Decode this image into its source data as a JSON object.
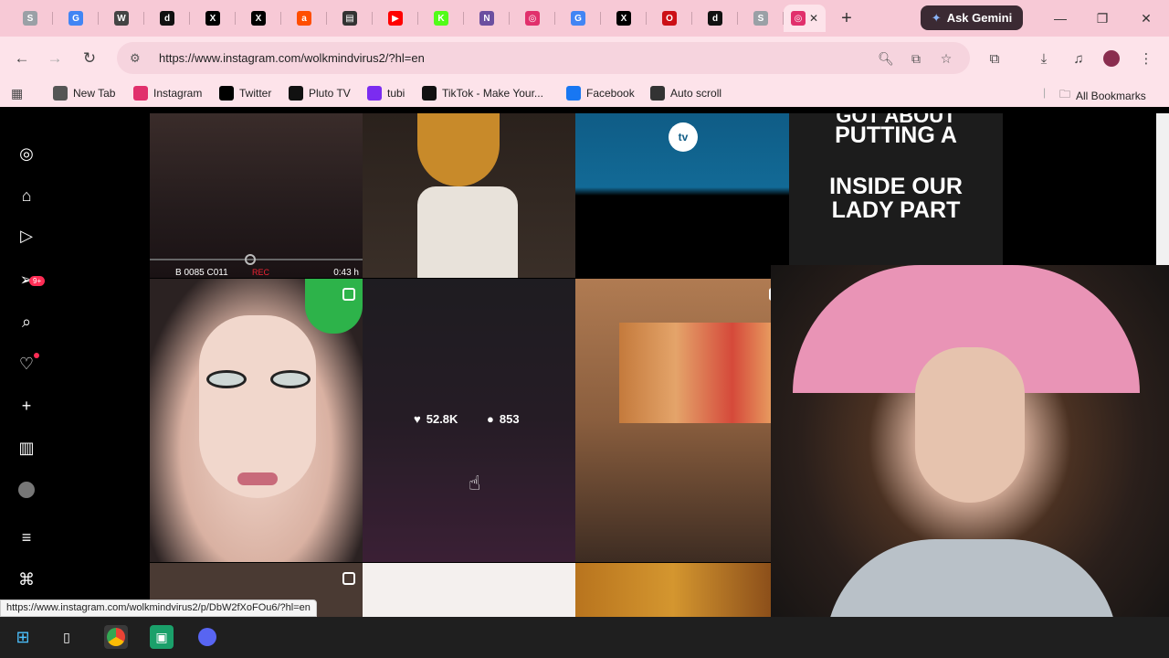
{
  "browser": {
    "tabs": [
      {
        "icon": "chrome-icon",
        "color": "#9aa0a6",
        "label": "S"
      },
      {
        "icon": "google-icon",
        "color": "#4285f4",
        "label": "G"
      },
      {
        "icon": "app-icon",
        "color": "#444444",
        "label": "W"
      },
      {
        "icon": "tiktok-icon",
        "color": "#111111",
        "label": "d"
      },
      {
        "icon": "x-icon",
        "color": "#000000",
        "label": "X"
      },
      {
        "icon": "x-icon",
        "color": "#000000",
        "label": "X"
      },
      {
        "icon": "ars-icon",
        "color": "#ff4e00",
        "label": "a"
      },
      {
        "icon": "news-icon",
        "color": "#333333",
        "label": "▤"
      },
      {
        "icon": "youtube-icon",
        "color": "#ff0000",
        "label": "▶"
      },
      {
        "icon": "kick-icon",
        "color": "#53fc18",
        "label": "K"
      },
      {
        "icon": "nbc-icon",
        "color": "#6b4fa0",
        "label": "N"
      },
      {
        "icon": "instagram-icon",
        "color": "#e1306c",
        "label": "◎"
      },
      {
        "icon": "google-icon",
        "color": "#4285f4",
        "label": "G"
      },
      {
        "icon": "x-icon",
        "color": "#000000",
        "label": "X"
      },
      {
        "icon": "opera-icon",
        "color": "#cc0f16",
        "label": "O"
      },
      {
        "icon": "tiktok-icon",
        "color": "#111111",
        "label": "d"
      },
      {
        "icon": "chrome-icon",
        "color": "#9aa0a6",
        "label": "S"
      }
    ],
    "new_tab_label": "+",
    "ask_gemini_label": "Ask Gemini",
    "url": "https://www.instagram.com/wolkmindvirus2/?hl=en",
    "bookmarks": [
      {
        "icon": "globe-icon",
        "label": "New Tab"
      },
      {
        "icon": "instagram-icon",
        "label": "Instagram"
      },
      {
        "icon": "x-icon",
        "label": "Twitter"
      },
      {
        "icon": "pluto-icon",
        "label": "Pluto TV"
      },
      {
        "icon": "tubi-icon",
        "label": "tubi"
      },
      {
        "icon": "tiktok-icon",
        "label": "TikTok - Make Your..."
      },
      {
        "icon": "facebook-icon",
        "label": "Facebook"
      },
      {
        "icon": "autoscroll-icon",
        "label": "Auto scroll"
      }
    ],
    "all_bookmarks_label": "All Bookmarks",
    "status_url": "https://www.instagram.com/wolkmindvirus2/p/DbW2fXoFOu6/?hl=en"
  },
  "instagram": {
    "notifications_badge": "9+",
    "tiles": {
      "rec_label": "B  0085  C011",
      "rec_tag": "REC",
      "rec_duration": "0:43 h",
      "tv_logo": "tv",
      "t4_line1": "GOT ABOUT",
      "t4_line2": "PUTTING A",
      "t4_line3": "INSIDE OUR",
      "t4_line4": "LADY PART",
      "hover_likes": "52.8K",
      "hover_comments": "853"
    }
  },
  "colors": {
    "tabstrip": "#f7c9d6",
    "toolbar": "#fde3ea",
    "gemini": "#3b2a33"
  }
}
